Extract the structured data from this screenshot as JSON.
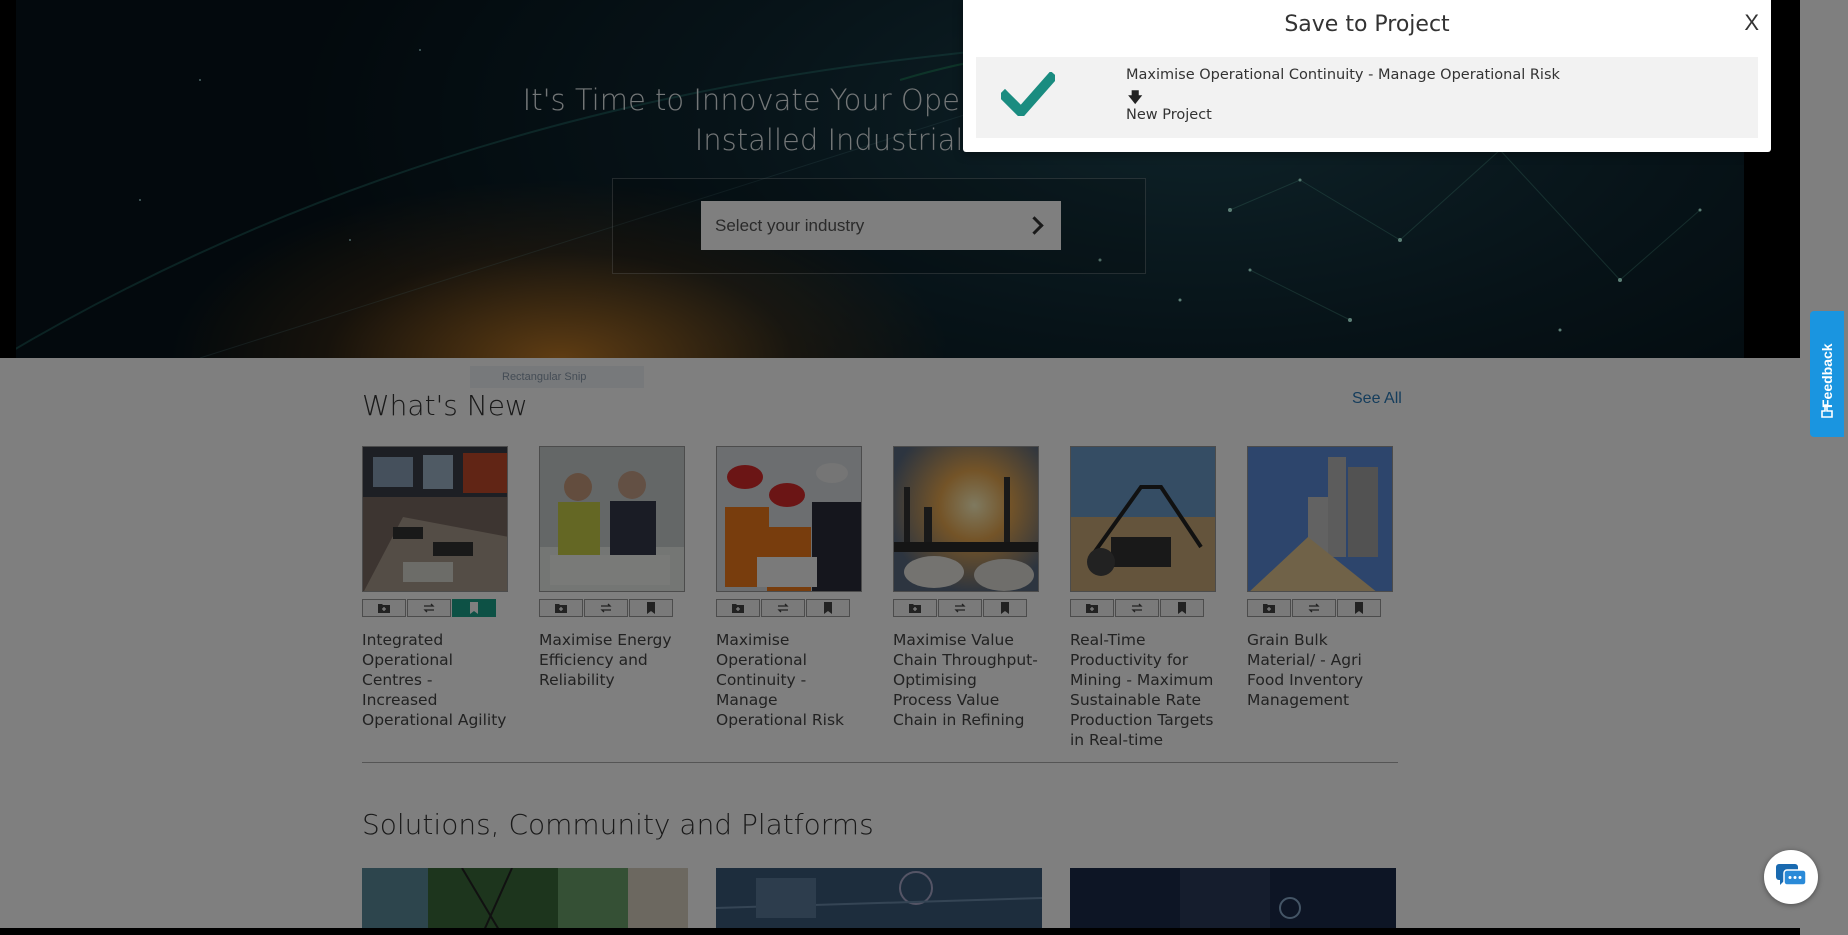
{
  "hero": {
    "title_line1": "It's Time to Innovate Your Operational Potential",
    "title_line2": "Installed Industrial Solu",
    "industry_placeholder": "Select your industry"
  },
  "snip_label": "Rectangular Snip",
  "whats_new": {
    "title": "What's New",
    "see_all": "See All",
    "cards": [
      {
        "title": "Integrated Operational Centres - Increased Operational Agility",
        "saved": true
      },
      {
        "title": "Maximise Energy Efficiency and Reliability",
        "saved": false
      },
      {
        "title": "Maximise Operational Continuity - Manage Operational Risk",
        "saved": false
      },
      {
        "title": "Maximise Value Chain Throughput- Optimising Process Value Chain in Refining",
        "saved": false
      },
      {
        "title": "Real-Time Productivity for Mining - Maximum Sustainable Rate Production Targets in Real-time",
        "saved": false
      },
      {
        "title": "Grain Bulk Material/ - Agri Food Inventory Management",
        "saved": false
      }
    ]
  },
  "solutions": {
    "title": "Solutions, Community and Platforms"
  },
  "modal": {
    "title": "Save to Project",
    "close": "X",
    "from": "Maximise Operational Continuity - Manage Operational Risk",
    "to": "New Project"
  },
  "feedback_label": "Feedback",
  "colors": {
    "accent": "#1aa38a",
    "feedback": "#1a95e0",
    "link": "#2a7ab8"
  }
}
